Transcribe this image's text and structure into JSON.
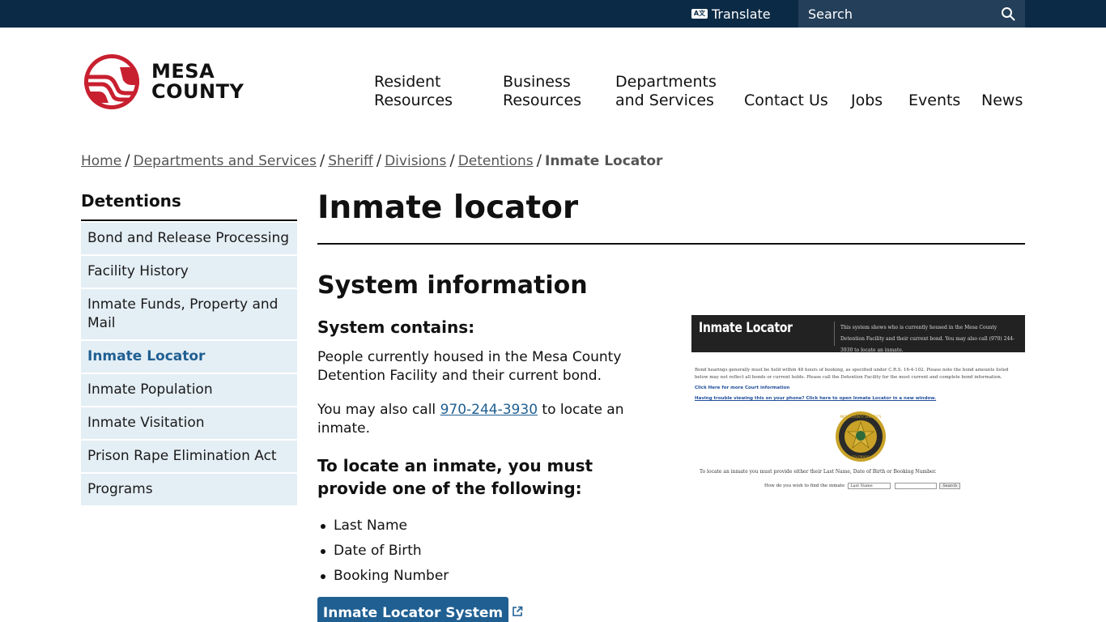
{
  "topbar": {
    "translate_label": "Translate",
    "search_placeholder": "Search"
  },
  "header": {
    "logo_line1": "MESA",
    "logo_line2": "COUNTY",
    "nav": [
      {
        "line1": "Resident",
        "line2": "Resources"
      },
      {
        "line1": "Business",
        "line2": "Resources"
      },
      {
        "line1": "Departments",
        "line2": "and Services"
      },
      {
        "line1": "",
        "line2": "Contact Us"
      },
      {
        "line1": "",
        "line2": "Jobs"
      },
      {
        "line1": "",
        "line2": "Events"
      },
      {
        "line1": "",
        "line2": "News"
      }
    ]
  },
  "breadcrumb": {
    "items": [
      "Home",
      "Departments and Services",
      "Sheriff",
      "Divisions",
      "Detentions"
    ],
    "current": "Inmate Locator",
    "separator": "/"
  },
  "sidebar": {
    "title": "Detentions",
    "items": [
      {
        "label": "Bond and Release Processing",
        "active": false
      },
      {
        "label": "Facility History",
        "active": false
      },
      {
        "label": "Inmate Funds, Property and Mail",
        "active": false
      },
      {
        "label": "Inmate Locator",
        "active": true
      },
      {
        "label": "Inmate Population",
        "active": false
      },
      {
        "label": "Inmate Visitation",
        "active": false
      },
      {
        "label": "Prison Rape Elimination Act",
        "active": false
      },
      {
        "label": "Programs",
        "active": false
      }
    ]
  },
  "main": {
    "title": "Inmate locator",
    "section_title": "System information",
    "contains_heading": "System contains:",
    "contains_text": "People currently housed in the Mesa County Detention Facility and their current bond.",
    "call_prefix": "You may also call ",
    "call_phone": "970-244-3930",
    "call_suffix": " to locate an inmate.",
    "locate_heading": "To locate an inmate, you must provide one of the following:",
    "requirements": [
      "Last Name",
      "Date of Birth",
      "Booking Number"
    ],
    "cta_label": "Inmate Locator System"
  },
  "preview": {
    "title": "Inmate Locator",
    "head_text": "This system shows who is currently housed in the Mesa County Detention Facility and their current bond. You may also call (970) 244-3930 to locate an inmate.",
    "body_text": "Bond hearings generally must be held within 48 hours of booking, as specified under C.R.S. 16-4-102.  Please note the bond amounts listed below may not reflect all bonds or current holds. Please call the Detention Facility for the most current and complete bond information.",
    "link1": "Click Here for more Court information",
    "link2": "Having trouble viewing this on your phone? Click here to open Inmate Locator in a new window.",
    "seal_text_top": "MESA COUNTY SHERIFF'S",
    "seal_text_bottom": "COLORADO",
    "requirement_text": "To locate an inmate you must provide either their Last Name, Date of Birth or Booking Number.",
    "form_label": "How do you wish to find the inmate",
    "select_value": "Last Name",
    "search_button": "Search"
  },
  "colors": {
    "topbar": "#0b2a45",
    "accent_blue": "#1f5f92",
    "logo_red": "#c8202f",
    "sidebar_bg": "#e4eef5"
  }
}
